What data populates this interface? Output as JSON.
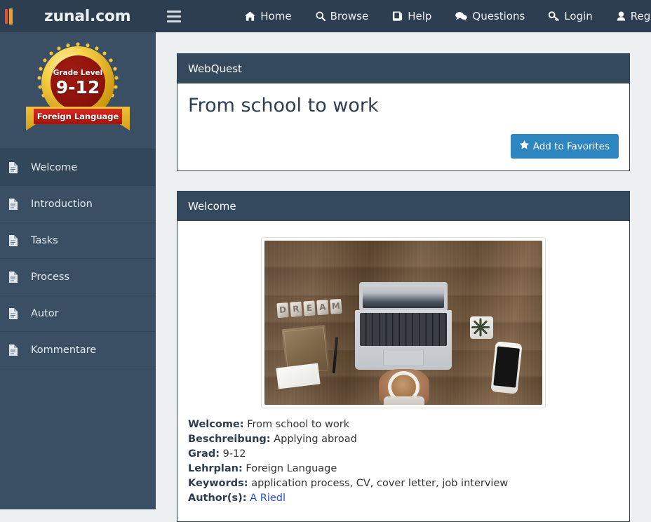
{
  "site": {
    "brand": "zunal.com",
    "logo_icon": "book-logo-icon",
    "menu_toggle_icon": "hamburger-icon",
    "colors": {
      "navbar_bg": "#2c3e50",
      "sidebar_bg": "#3a4f63",
      "panel_header_bg": "#34495e",
      "page_bg": "#ecf0f1",
      "primary_button": "#2e86c1",
      "link": "#2a4fcf",
      "seal_gold": "#d4a017",
      "seal_red": "#8e130c"
    }
  },
  "nav": {
    "items": [
      {
        "label": "Home",
        "icon": "home-icon"
      },
      {
        "label": "Browse",
        "icon": "search-icon"
      },
      {
        "label": "Help",
        "icon": "book-icon"
      },
      {
        "label": "Questions",
        "icon": "comments-icon"
      },
      {
        "label": "Login",
        "icon": "key-icon"
      },
      {
        "label": "Register",
        "icon": "user-icon"
      }
    ]
  },
  "sidebar": {
    "badge": {
      "grade_label": "Grade Level",
      "grade_value": "9-12",
      "subject": "Foreign Language"
    },
    "items": [
      {
        "label": "Welcome",
        "icon": "file-icon",
        "active": true
      },
      {
        "label": "Introduction",
        "icon": "file-icon",
        "active": false
      },
      {
        "label": "Tasks",
        "icon": "file-icon",
        "active": false
      },
      {
        "label": "Process",
        "icon": "file-icon",
        "active": false
      },
      {
        "label": "Autor",
        "icon": "file-icon",
        "active": false
      },
      {
        "label": "Kommentare",
        "icon": "file-icon",
        "active": false
      }
    ]
  },
  "webquest_panel": {
    "header": "WebQuest",
    "title": "From school to work",
    "favorite_button": {
      "label": "Add to Favorites",
      "icon": "star-icon"
    }
  },
  "welcome_panel": {
    "header": "Welcome",
    "image": {
      "alt": "flat-lay desk photo with laptop, DREAM letters, notebook, plant, phone and hands holding coffee",
      "dream_letters": [
        "D",
        "R",
        "E",
        "A",
        "M"
      ]
    },
    "meta": [
      {
        "label": "Welcome:",
        "value": "From school to work",
        "link": false
      },
      {
        "label": "Beschreibung:",
        "value": "Applying abroad",
        "link": false
      },
      {
        "label": "Grad:",
        "value": "9-12",
        "link": false
      },
      {
        "label": "Lehrplan:",
        "value": "Foreign Language",
        "link": false
      },
      {
        "label": "Keywords:",
        "value": "application process, CV, cover letter, job interview",
        "link": false
      },
      {
        "label": "Author(s):",
        "value": "A Riedl",
        "link": true
      }
    ]
  }
}
